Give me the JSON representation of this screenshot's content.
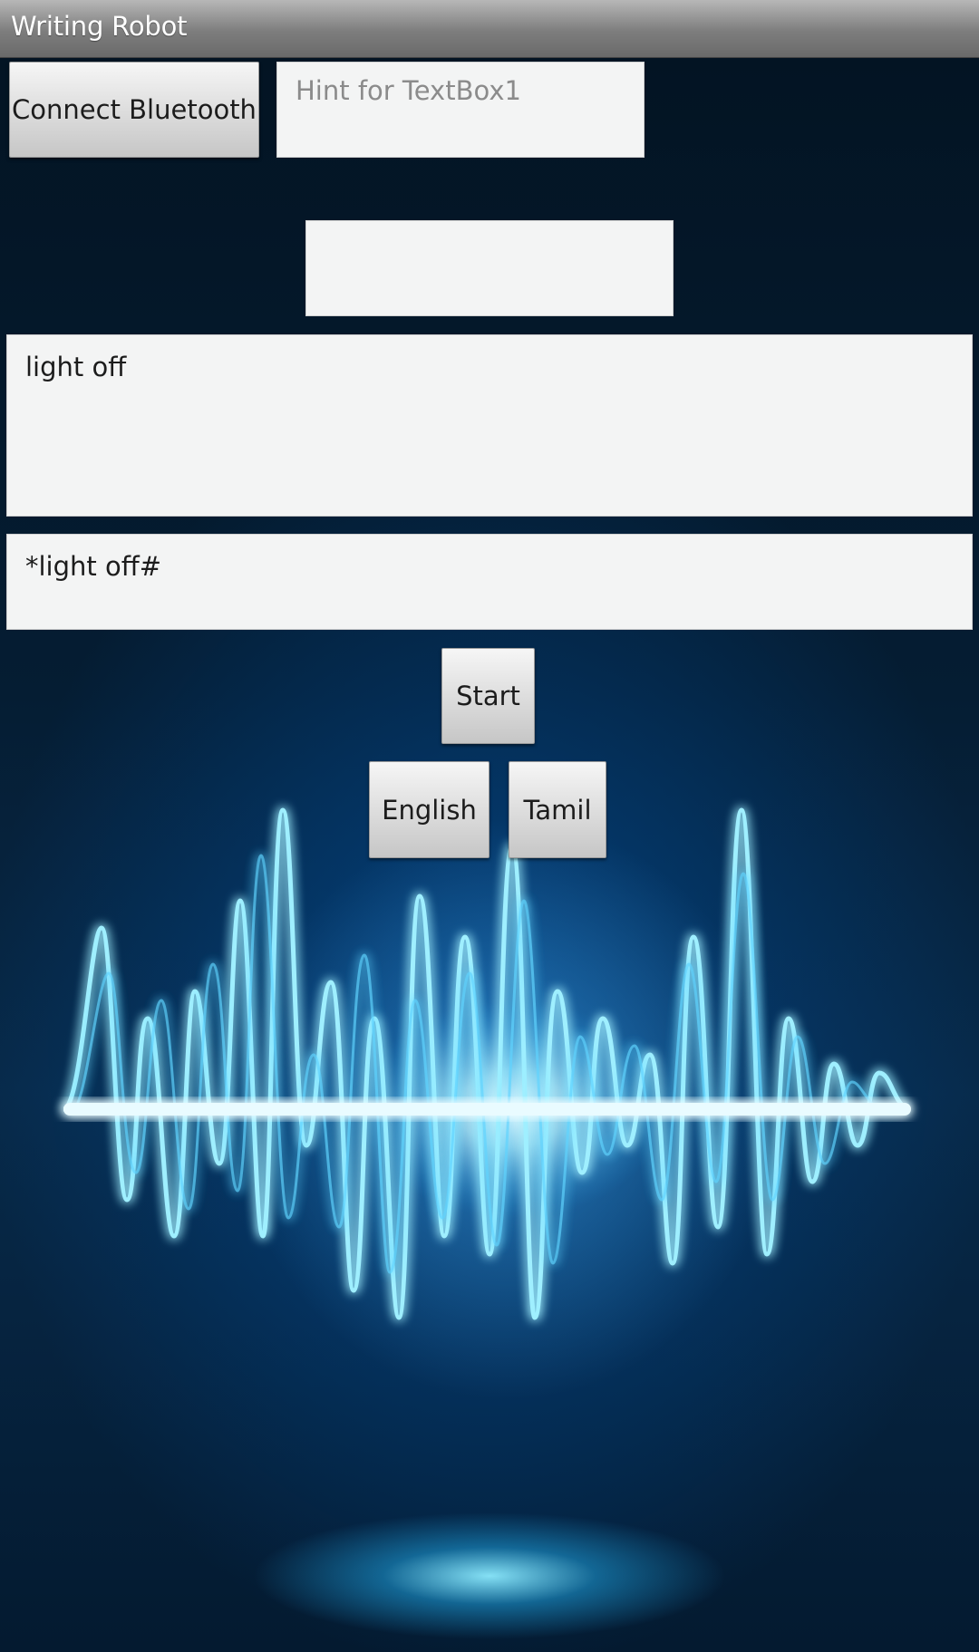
{
  "app": {
    "title": "Writing Robot"
  },
  "controls": {
    "connect_label": "Connect Bluetooth",
    "textbox1_placeholder": "Hint for TextBox1",
    "textbox2_value": "",
    "recognized_text": "light off",
    "command_text": "*light off#",
    "start_label": "Start",
    "english_label": "English",
    "tamil_label": "Tamil"
  },
  "colors": {
    "background": "#02101e",
    "wave_glow": "#7fe6ff",
    "field_bg": "#f3f4f4",
    "button_bg": "#dcdcdc"
  }
}
